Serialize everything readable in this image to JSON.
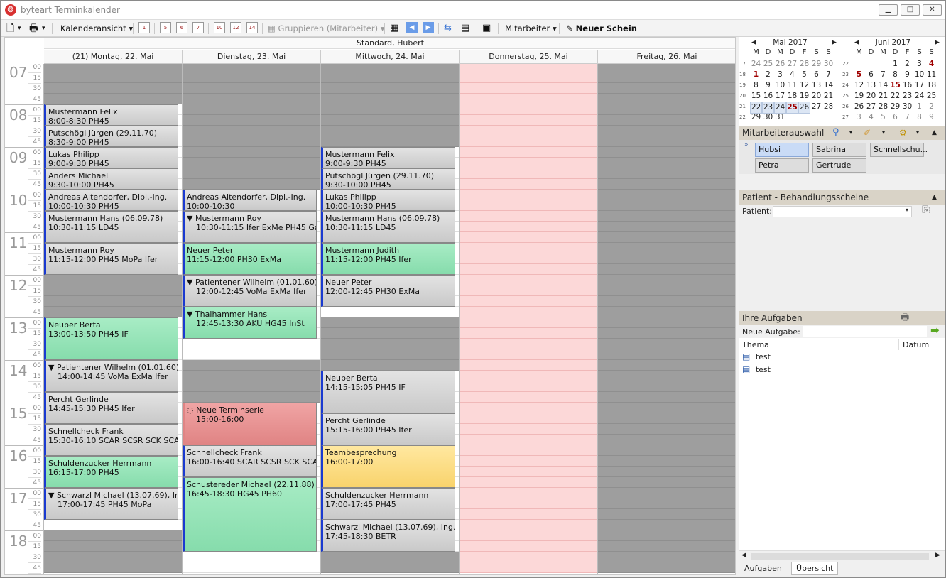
{
  "window": {
    "title": "byteart Terminkalender",
    "min": "▁",
    "max": "□",
    "close": "✕"
  },
  "toolbar": {
    "new": "🗋",
    "print": "🖶",
    "view_label": "Kalenderansicht",
    "group_label": "Gruppieren (Mitarbeiter)",
    "staff_label": "Mitarbeiter",
    "new_slip_label": "Neuer Schein",
    "day_icons": [
      "1",
      "5",
      "6",
      "7",
      "10",
      "12",
      "14"
    ]
  },
  "calendar": {
    "header_title": "Standard, Hubert",
    "days": [
      {
        "label": "(21) Montag, 22. Mai"
      },
      {
        "label": "Dienstag, 23. Mai"
      },
      {
        "label": "Mittwoch, 24. Mai"
      },
      {
        "label": "Donnerstag, 25. Mai"
      },
      {
        "label": "Freitag, 26. Mai"
      }
    ],
    "hours": [
      "07",
      "08",
      "09",
      "10",
      "11",
      "12",
      "13",
      "14",
      "15",
      "16",
      "17",
      "18"
    ],
    "minutes": [
      "00",
      "15",
      "30",
      "45"
    ],
    "appointments": [
      {
        "day": 0,
        "start": "08:00",
        "end": "08:30",
        "name": "Mustermann Felix",
        "detail": "8:00-8:30 PH45",
        "color": "gray"
      },
      {
        "day": 0,
        "start": "08:30",
        "end": "09:00",
        "name": "Putschögl Jürgen (29.11.70)",
        "detail": "8:30-9:00 PH45",
        "color": "gray"
      },
      {
        "day": 0,
        "start": "09:00",
        "end": "09:30",
        "name": "Lukas Philipp",
        "detail": "9:00-9:30 PH45",
        "color": "gray"
      },
      {
        "day": 0,
        "start": "09:30",
        "end": "10:00",
        "name": "Anders Michael",
        "detail": "9:30-10:00 PH45",
        "color": "gray"
      },
      {
        "day": 0,
        "start": "10:00",
        "end": "10:30",
        "name": "Andreas Altendorfer, Dipl.-Ing.",
        "detail": "10:00-10:30 PH45",
        "color": "gray"
      },
      {
        "day": 0,
        "start": "10:30",
        "end": "11:15",
        "name": "Mustermann Hans (06.09.78)",
        "detail": "10:30-11:15 LD45",
        "color": "gray"
      },
      {
        "day": 0,
        "start": "11:15",
        "end": "12:00",
        "name": "Mustermann Roy",
        "detail": "11:15-12:00 PH45 MoPa Ifer",
        "color": "gray"
      },
      {
        "day": 0,
        "start": "13:00",
        "end": "14:00",
        "name": "Neuper Berta",
        "detail": "13:00-13:50 PH45 IF",
        "color": "green"
      },
      {
        "day": 0,
        "start": "14:00",
        "end": "14:45",
        "name": "▼ Patientener Wilhelm (01.01.60)",
        "detail": "14:00-14:45 VoMa ExMa Ifer",
        "color": "gray",
        "indent": true
      },
      {
        "day": 0,
        "start": "14:45",
        "end": "15:30",
        "name": "Percht Gerlinde",
        "detail": "14:45-15:30 PH45 Ifer",
        "color": "gray"
      },
      {
        "day": 0,
        "start": "15:30",
        "end": "16:15",
        "name": "Schnellcheck Frank",
        "detail": "15:30-16:10 SCAR SCSR SCK SCAK",
        "color": "gray"
      },
      {
        "day": 0,
        "start": "16:15",
        "end": "17:00",
        "name": "Schuldenzucker Herrmann",
        "detail": "16:15-17:00 PH45",
        "color": "green"
      },
      {
        "day": 0,
        "start": "17:00",
        "end": "17:45",
        "name": "▼ Schwarzl Michael (13.07.69), Ing.",
        "detail": "17:00-17:45 PH45 MoPa",
        "color": "gray",
        "indent": true
      },
      {
        "day": 1,
        "start": "10:00",
        "end": "10:30",
        "name": "Andreas Altendorfer, Dipl.-Ing.",
        "detail": "10:00-10:30",
        "color": "gray"
      },
      {
        "day": 1,
        "start": "10:30",
        "end": "11:15",
        "name": "▼ Mustermann Roy",
        "detail": "10:30-11:15 Ifer ExMe PH45 Galv",
        "color": "gray",
        "indent": true
      },
      {
        "day": 1,
        "start": "11:15",
        "end": "12:00",
        "name": "Neuer Peter",
        "detail": "11:15-12:00 PH30 ExMa",
        "color": "green"
      },
      {
        "day": 1,
        "start": "12:00",
        "end": "12:45",
        "name": "▼ Patientener Wilhelm (01.01.60)",
        "detail": "12:00-12:45 VoMa ExMa Ifer",
        "color": "gray",
        "indent": true
      },
      {
        "day": 1,
        "start": "12:45",
        "end": "13:30",
        "name": "▼ Thalhammer Hans",
        "detail": "12:45-13:30 AKU HG45 InSt",
        "color": "green",
        "indent": true
      },
      {
        "day": 1,
        "start": "15:00",
        "end": "16:00",
        "name": "◌ Neue Terminserie",
        "detail": "15:00-16:00",
        "color": "red",
        "indent": true
      },
      {
        "day": 1,
        "start": "16:00",
        "end": "16:45",
        "name": "Schnellcheck Frank",
        "detail": "16:00-16:40 SCAR SCSR SCK SCAK",
        "color": "gray"
      },
      {
        "day": 1,
        "start": "16:45",
        "end": "18:30",
        "name": "Schustereder Michael (22.11.88)",
        "detail": "16:45-18:30 HG45 PH60",
        "color": "green"
      },
      {
        "day": 2,
        "start": "09:00",
        "end": "09:30",
        "name": "Mustermann Felix",
        "detail": "9:00-9:30 PH45",
        "color": "gray"
      },
      {
        "day": 2,
        "start": "09:30",
        "end": "10:00",
        "name": "Putschögl Jürgen (29.11.70)",
        "detail": "9:30-10:00 PH45",
        "color": "gray"
      },
      {
        "day": 2,
        "start": "10:00",
        "end": "10:30",
        "name": "Lukas Philipp",
        "detail": "10:00-10:30 PH45",
        "color": "gray"
      },
      {
        "day": 2,
        "start": "10:30",
        "end": "11:15",
        "name": "Mustermann Hans (06.09.78)",
        "detail": "10:30-11:15 LD45",
        "color": "gray"
      },
      {
        "day": 2,
        "start": "11:15",
        "end": "12:00",
        "name": "Mustermann Judith",
        "detail": "11:15-12:00 PH45 Ifer",
        "color": "green"
      },
      {
        "day": 2,
        "start": "12:00",
        "end": "12:45",
        "name": "Neuer Peter",
        "detail": "12:00-12:45 PH30 ExMa",
        "color": "gray"
      },
      {
        "day": 2,
        "start": "14:15",
        "end": "15:15",
        "name": "Neuper Berta",
        "detail": "14:15-15:05 PH45 IF",
        "color": "gray"
      },
      {
        "day": 2,
        "start": "15:15",
        "end": "16:00",
        "name": "Percht Gerlinde",
        "detail": "15:15-16:00 PH45 Ifer",
        "color": "gray"
      },
      {
        "day": 2,
        "start": "16:00",
        "end": "17:00",
        "name": "Teambesprechung",
        "detail": "16:00-17:00",
        "color": "yellow"
      },
      {
        "day": 2,
        "start": "17:00",
        "end": "17:45",
        "name": "Schuldenzucker Herrmann",
        "detail": "17:00-17:45 PH45",
        "color": "gray"
      },
      {
        "day": 2,
        "start": "17:45",
        "end": "18:30",
        "name": "Schwarzl Michael (13.07.69), Ing.",
        "detail": "17:45-18:30 BETR",
        "color": "gray"
      }
    ]
  },
  "mini_calendars": [
    {
      "title": "Mai 2017",
      "prev": "◀",
      "next": "▶",
      "weekdays": [
        "M",
        "D",
        "M",
        "D",
        "F",
        "S",
        "S"
      ],
      "weeks": [
        "17",
        "18",
        "19",
        "20",
        "21",
        "22"
      ],
      "rows": [
        [
          "24",
          "25",
          "26",
          "27",
          "28",
          "29",
          "30"
        ],
        [
          "1",
          "2",
          "3",
          "4",
          "5",
          "6",
          "7"
        ],
        [
          "8",
          "9",
          "10",
          "11",
          "12",
          "13",
          "14"
        ],
        [
          "15",
          "16",
          "17",
          "18",
          "19",
          "20",
          "21"
        ],
        [
          "22",
          "23",
          "24",
          "25",
          "26",
          "27",
          "28"
        ],
        [
          "29",
          "30",
          "31",
          "",
          "",
          "",
          ""
        ]
      ]
    },
    {
      "title": "Juni 2017",
      "prev": "◀",
      "next": "▶",
      "weekdays": [
        "M",
        "D",
        "M",
        "D",
        "F",
        "S",
        "S"
      ],
      "weeks": [
        "22",
        "23",
        "24",
        "25",
        "26",
        "27"
      ],
      "rows": [
        [
          "",
          "",
          "",
          "1",
          "2",
          "3",
          "4"
        ],
        [
          "5",
          "6",
          "7",
          "8",
          "9",
          "10",
          "11"
        ],
        [
          "12",
          "13",
          "14",
          "15",
          "16",
          "17",
          "18"
        ],
        [
          "19",
          "20",
          "21",
          "22",
          "23",
          "24",
          "25"
        ],
        [
          "26",
          "27",
          "28",
          "29",
          "30",
          "1",
          "2"
        ],
        [
          "3",
          "4",
          "5",
          "6",
          "7",
          "8",
          "9"
        ]
      ]
    }
  ],
  "staff_panel": {
    "title": "Mitarbeiterauswahl",
    "employees": [
      "Hubsi",
      "Sabrina",
      "Schnellschu...",
      "Petra",
      "Gertrude"
    ]
  },
  "patient_panel": {
    "title": "Patient - Behandlungsscheine",
    "patient_label": "Patient:",
    "patient_value": ""
  },
  "tasks_panel": {
    "title": "Ihre Aufgaben",
    "new_task_label": "Neue Aufgabe:",
    "col_topic": "Thema",
    "col_date": "Datum",
    "tasks": [
      "test",
      "test"
    ]
  },
  "bottom_tabs": [
    "Aufgaben",
    "Übersicht"
  ]
}
